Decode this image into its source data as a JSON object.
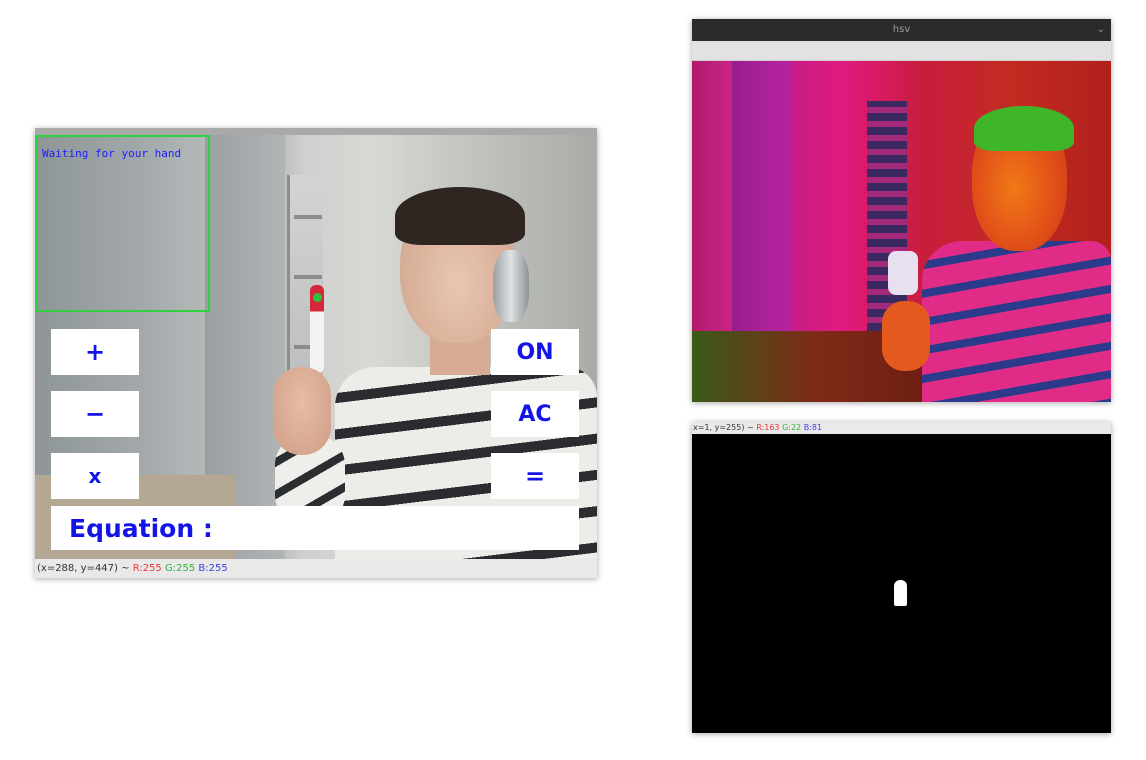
{
  "left_window": {
    "roi_text": "Waiting for your hand",
    "buttons": {
      "plus": "+",
      "minus": "−",
      "times": "x",
      "on": "ON",
      "ac": "AC",
      "equals": "="
    },
    "equation_label": "Equation :",
    "status": {
      "coords": "(x=288, y=447) ~",
      "r": "R:255",
      "g": "G:255",
      "b": "B:255"
    }
  },
  "hsv_window": {
    "title": "hsv",
    "chevron": "⌄"
  },
  "mask_window": {
    "status": {
      "coords": "x=1, y=255) ~",
      "r": "R:163",
      "g": "G:22",
      "b": "B:81"
    }
  },
  "colors": {
    "button_text": "#1414e6",
    "roi_border": "#2fd23a",
    "status_r": "#e23b3b",
    "status_g": "#36b23b",
    "status_b": "#3b43e2"
  }
}
